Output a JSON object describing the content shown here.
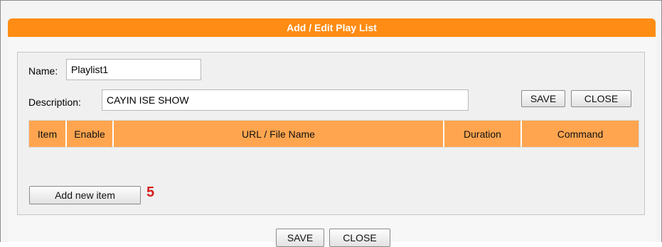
{
  "window": {
    "title": "Add / Edit Play List"
  },
  "form": {
    "name_label": "Name:",
    "name_value": "Playlist1",
    "description_label": "Description:",
    "description_value": "CAYIN ISE SHOW"
  },
  "toolbar": {
    "save_label": "SAVE",
    "close_label": "CLOSE"
  },
  "table": {
    "columns": [
      "Item",
      "Enable",
      "URL / File Name",
      "Duration",
      "Command"
    ]
  },
  "add_item": {
    "label": "Add new item",
    "step_number": "5"
  },
  "footer": {
    "save_label": "SAVE",
    "close_label": "CLOSE"
  },
  "colors": {
    "title_bar": "#ff8c14",
    "table_header": "#ffa54f",
    "step_number": "#d21e1e"
  }
}
